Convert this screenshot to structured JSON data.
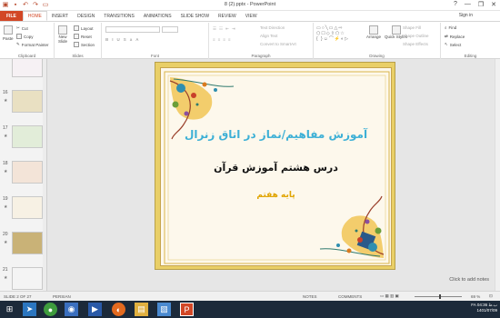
{
  "window": {
    "title": "8 (2).pptx - PowerPoint",
    "user": "Sign in",
    "controls": [
      "?",
      "—",
      "❐",
      "✕"
    ]
  },
  "tabs": [
    "FILE",
    "HOME",
    "INSERT",
    "DESIGN",
    "TRANSITIONS",
    "ANIMATIONS",
    "SLIDE SHOW",
    "REVIEW",
    "VIEW"
  ],
  "ribbon": {
    "clipboard": {
      "label": "Clipboard",
      "paste": "Paste",
      "cut": "Cut",
      "copy": "Copy",
      "format_painter": "Format Painter"
    },
    "slides": {
      "label": "Slides",
      "new_slide": "New",
      "new_slide2": "Slide",
      "layout": "Layout",
      "reset": "Reset",
      "section": "Section"
    },
    "font": {
      "label": "Font"
    },
    "paragraph": {
      "label": "Paragraph",
      "text_direction": "Text Direction",
      "align_text": "Align Text",
      "smartart": "Convert to SmartArt"
    },
    "drawing": {
      "label": "Drawing",
      "arrange": "Arrange",
      "quick_styles": "Quick Styles",
      "shape_fill": "Shape Fill",
      "shape_outline": "Shape Outline",
      "shape_effects": "Shape Effects"
    },
    "editing": {
      "label": "Editing",
      "find": "Find",
      "replace": "Replace",
      "select": "Select"
    }
  },
  "thumbnails": [
    {
      "num": "15",
      "color": "#f6f1f4"
    },
    {
      "num": "16",
      "color": "#e9e0c2"
    },
    {
      "num": "17",
      "color": "#e2edd9"
    },
    {
      "num": "18",
      "color": "#f3e4d8"
    },
    {
      "num": "19",
      "color": "#f7f1e4"
    },
    {
      "num": "20",
      "color": "#c9b277"
    },
    {
      "num": "21",
      "color": "#f4f4f4"
    }
  ],
  "slide": {
    "title": "آموزش مفاهیم/نماز در اتاق زنرال",
    "subtitle": "درس هشتم آموزش قرآن",
    "grade": "پایه هفتم"
  },
  "notes_placeholder": "Click to add notes",
  "status": {
    "slide_info": "SLIDE 2 OF 27",
    "language": "PERSIAN",
    "notes": "NOTES",
    "comments": "COMMENTS",
    "zoom": "69 %"
  },
  "tray": {
    "lang": "FA",
    "time": "04:36 ب.ظ",
    "date": "1401/07/09"
  }
}
